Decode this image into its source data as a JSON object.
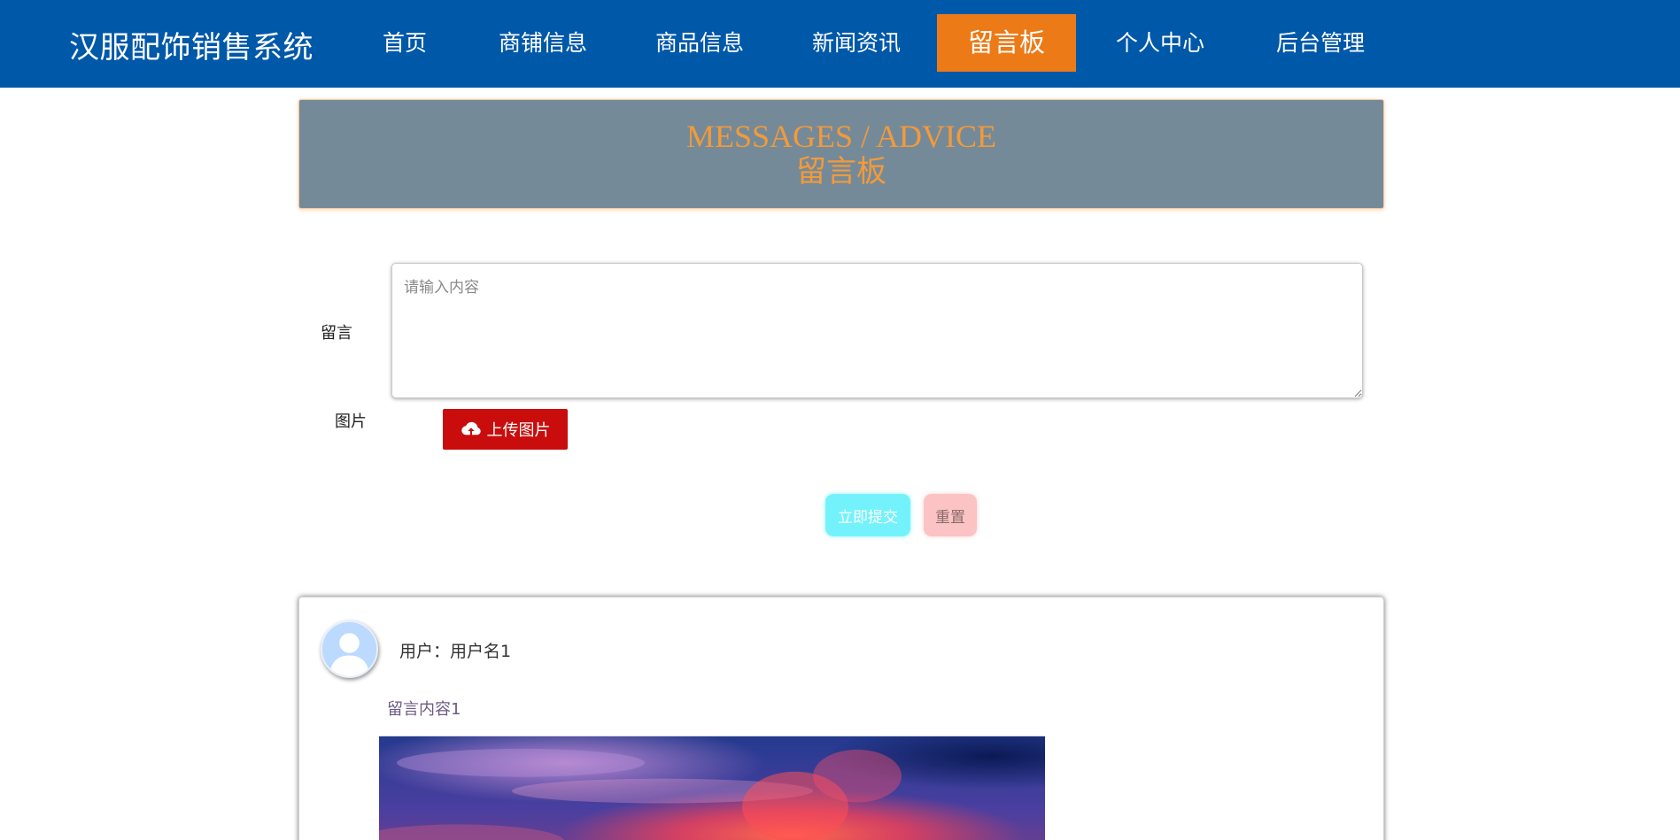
{
  "header": {
    "brand": "汉服配饰销售系统",
    "nav": [
      {
        "label": "首页",
        "active": false
      },
      {
        "label": "商铺信息",
        "active": false
      },
      {
        "label": "商品信息",
        "active": false
      },
      {
        "label": "新闻资讯",
        "active": false
      },
      {
        "label": "留言板",
        "active": true
      },
      {
        "label": "个人中心",
        "active": false
      },
      {
        "label": "后台管理",
        "active": false
      }
    ],
    "colors": {
      "bar": "#0058a9",
      "active": "#ec7a17"
    }
  },
  "banner": {
    "title_en": "MESSAGES / ADVICE",
    "title_cn": "留言板"
  },
  "form": {
    "message_label": "留言",
    "message_placeholder": "请输入内容",
    "message_value": "",
    "image_label": "图片",
    "upload_label": "上传图片",
    "upload_icon": "cloud-upload-icon",
    "submit_label": "立即提交",
    "reset_label": "重置"
  },
  "messages": [
    {
      "avatar_icon": "user-avatar-icon",
      "user_text": "用户：用户名1",
      "content": "留言内容1",
      "image": "sunset-sky-photo"
    }
  ]
}
